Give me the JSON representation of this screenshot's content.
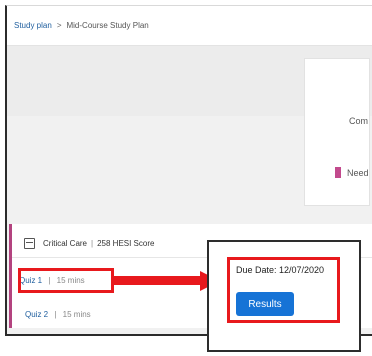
{
  "breadcrumb": {
    "root": "Study plan",
    "separator": ">",
    "current": "Mid-Course Study Plan"
  },
  "summary_card": {
    "partial_label_1": "Com",
    "partial_label_2": "Need",
    "swatch_color": "#c24a8d"
  },
  "section": {
    "title": "Critical Care",
    "separator": "|",
    "score": "258 HESI Score",
    "accent_color": "#b3437f",
    "icon": "folder-icon"
  },
  "quizzes": [
    {
      "label": "Quiz 1",
      "separator": "|",
      "duration": "15 mins"
    },
    {
      "label": "Quiz 2",
      "separator": "|",
      "duration": "15 mins"
    }
  ],
  "popup": {
    "due_date": "Due Date: 12/07/2020",
    "button_label": "Results",
    "button_color": "#1673d6"
  },
  "annotation": {
    "color": "#e8191d",
    "arrow_direction": "right"
  }
}
